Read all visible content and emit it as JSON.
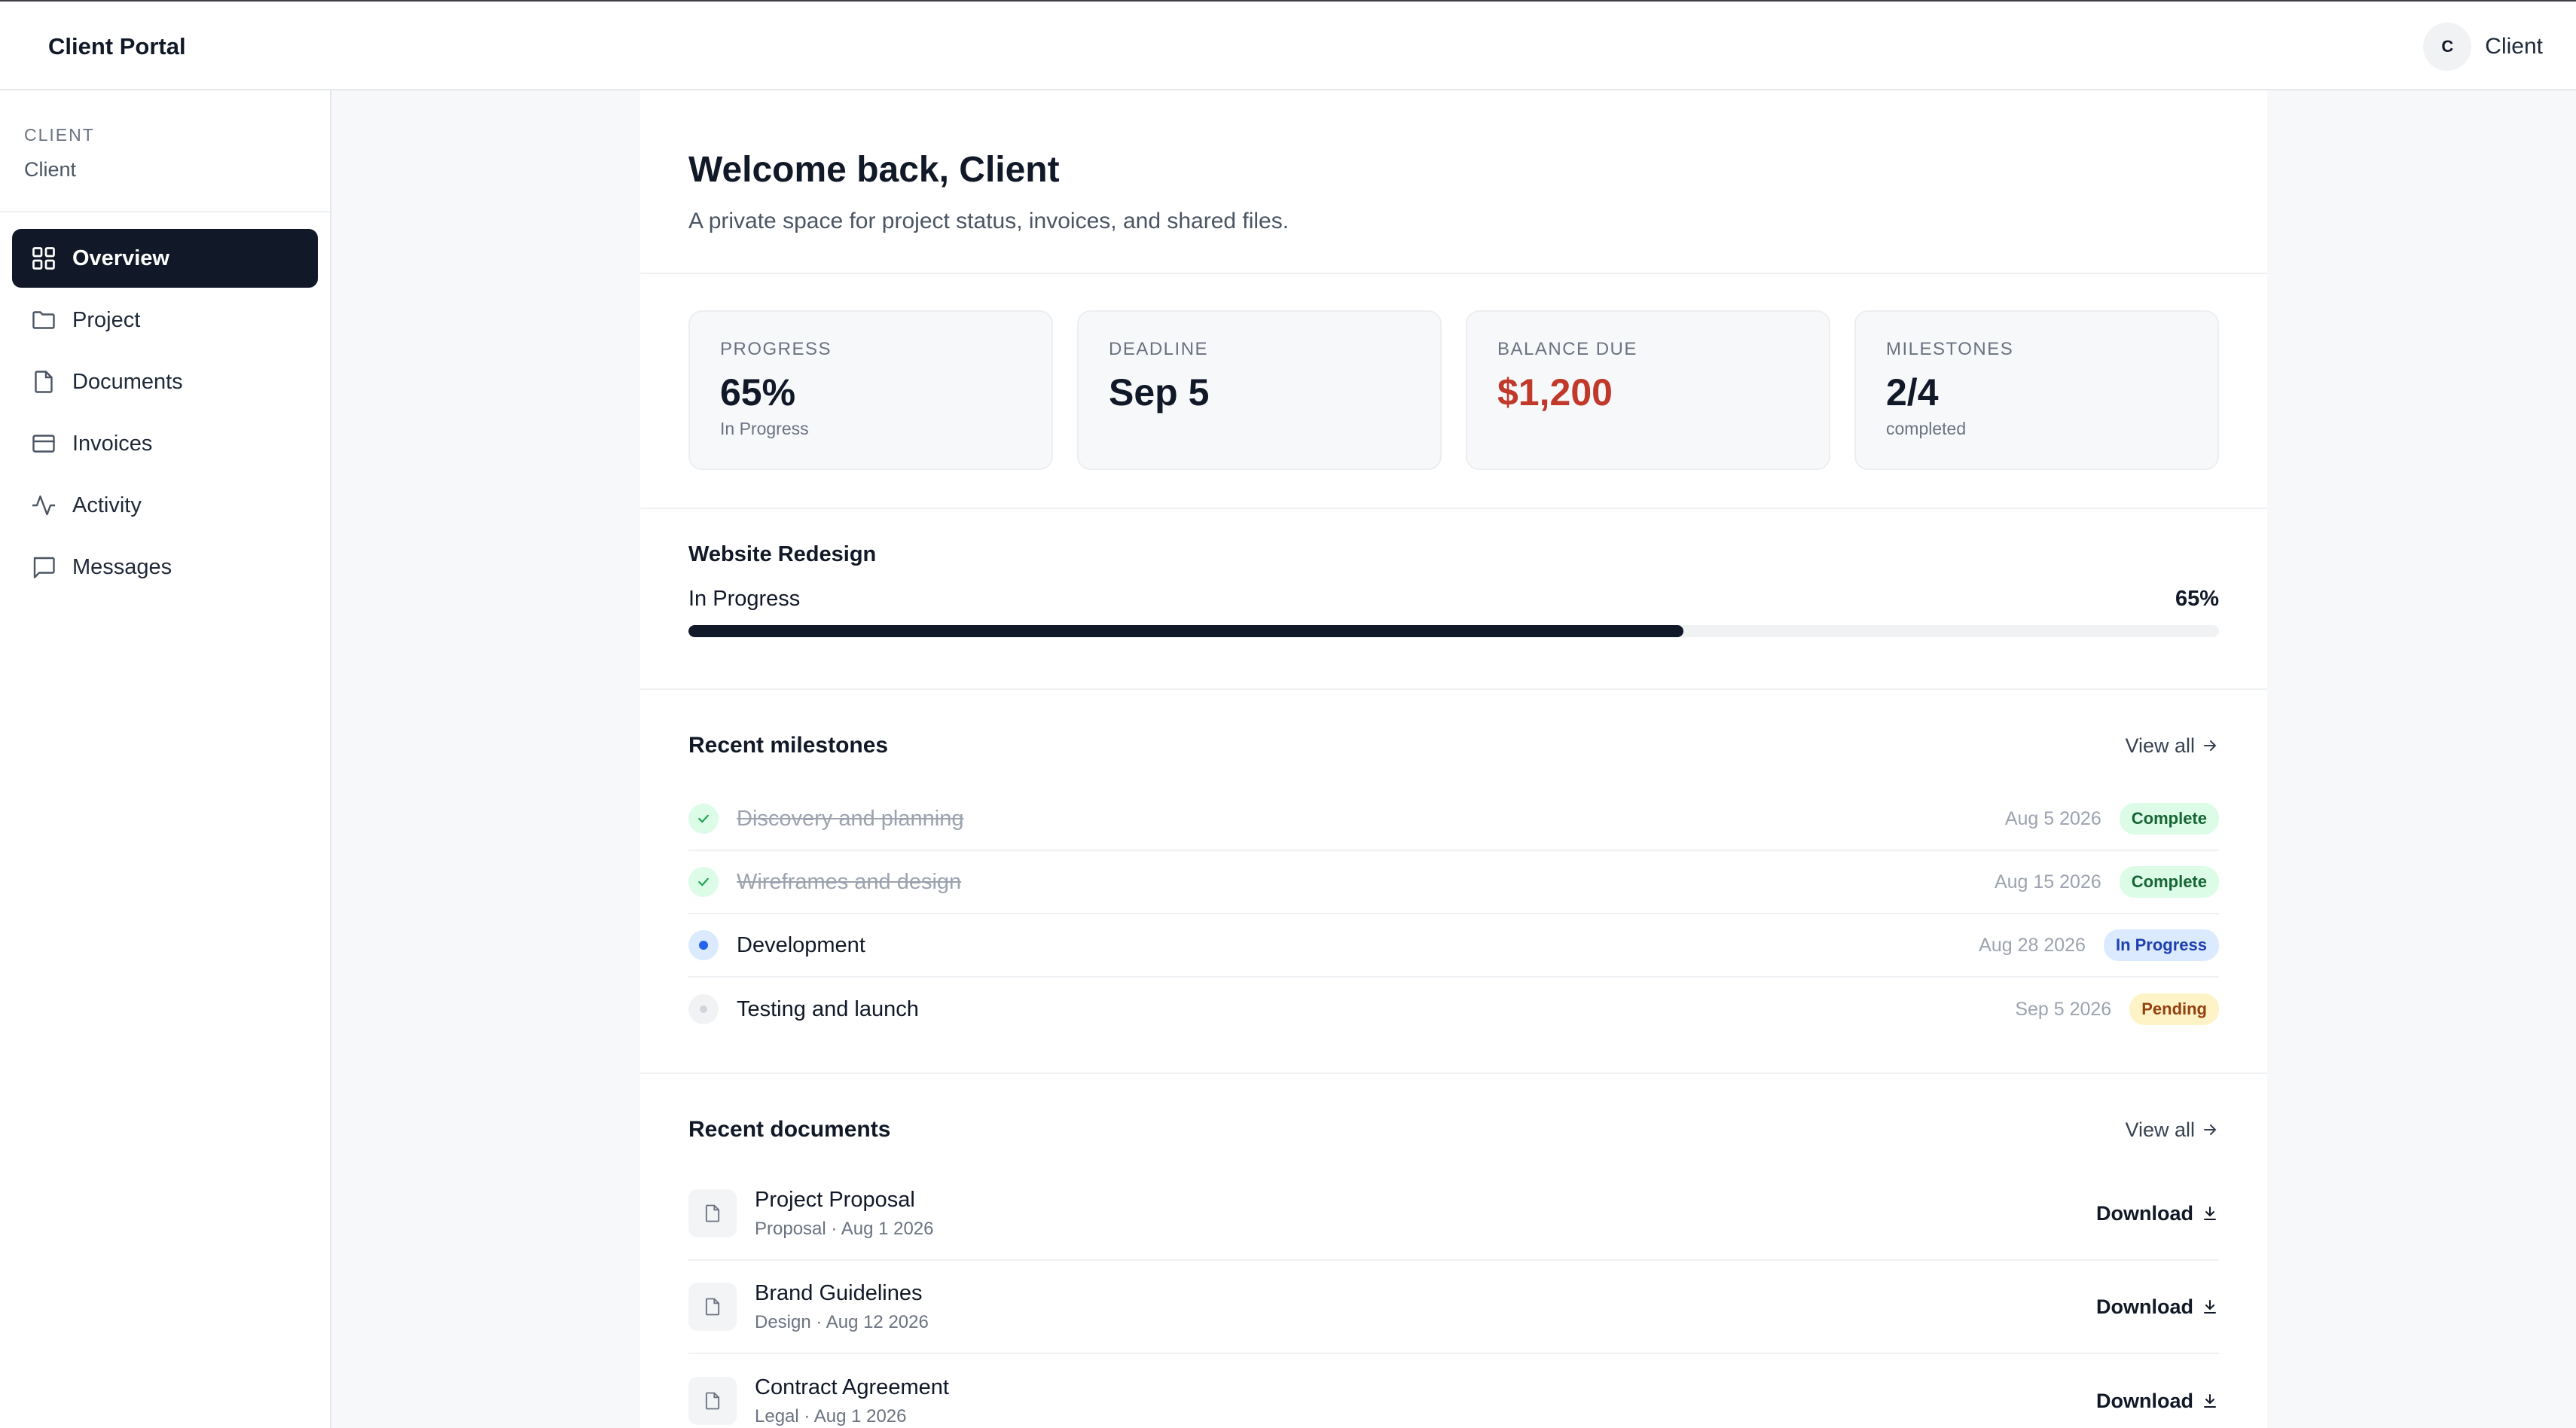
{
  "app": {
    "title": "Client Portal"
  },
  "user": {
    "initial": "C",
    "name": "Client"
  },
  "sidebar": {
    "section_label": "CLIENT",
    "client_name": "Client",
    "items": [
      {
        "label": "Overview",
        "icon": "grid-icon",
        "active": true
      },
      {
        "label": "Project",
        "icon": "folder-icon",
        "active": false
      },
      {
        "label": "Documents",
        "icon": "file-icon",
        "active": false
      },
      {
        "label": "Invoices",
        "icon": "credit-card-icon",
        "active": false
      },
      {
        "label": "Activity",
        "icon": "activity-icon",
        "active": false
      },
      {
        "label": "Messages",
        "icon": "message-icon",
        "active": false
      }
    ]
  },
  "welcome": {
    "title": "Welcome back, Client",
    "subtitle": "A private space for project status, invoices, and shared files."
  },
  "stats": [
    {
      "label": "PROGRESS",
      "value": "65%",
      "sub": "In Progress"
    },
    {
      "label": "DEADLINE",
      "value": "Sep 5",
      "sub": ""
    },
    {
      "label": "BALANCE DUE",
      "value": "$1,200",
      "sub": "",
      "color": "#c0392b"
    },
    {
      "label": "MILESTONES",
      "value": "2/4",
      "sub": "completed"
    }
  ],
  "project": {
    "name": "Website Redesign",
    "status": "In Progress",
    "percent_label": "65%",
    "percent": 65
  },
  "milestones": {
    "title": "Recent milestones",
    "view_all": "View all",
    "items": [
      {
        "name": "Discovery and planning",
        "date": "Aug 5 2026",
        "status": "Complete"
      },
      {
        "name": "Wireframes and design",
        "date": "Aug 15 2026",
        "status": "Complete"
      },
      {
        "name": "Development",
        "date": "Aug 28 2026",
        "status": "In Progress"
      },
      {
        "name": "Testing and launch",
        "date": "Sep 5 2026",
        "status": "Pending"
      }
    ]
  },
  "documents": {
    "title": "Recent documents",
    "view_all": "View all",
    "download_label": "Download",
    "items": [
      {
        "name": "Project Proposal",
        "meta": "Proposal · Aug 1 2026"
      },
      {
        "name": "Brand Guidelines",
        "meta": "Design · Aug 12 2026"
      },
      {
        "name": "Contract Agreement",
        "meta": "Legal · Aug 1 2026"
      }
    ]
  },
  "colors": {
    "accent": "#111827",
    "danger": "#c0392b",
    "success_bg": "#dcfce7",
    "info_bg": "#dbeafe",
    "warning_bg": "#fef3c7"
  }
}
